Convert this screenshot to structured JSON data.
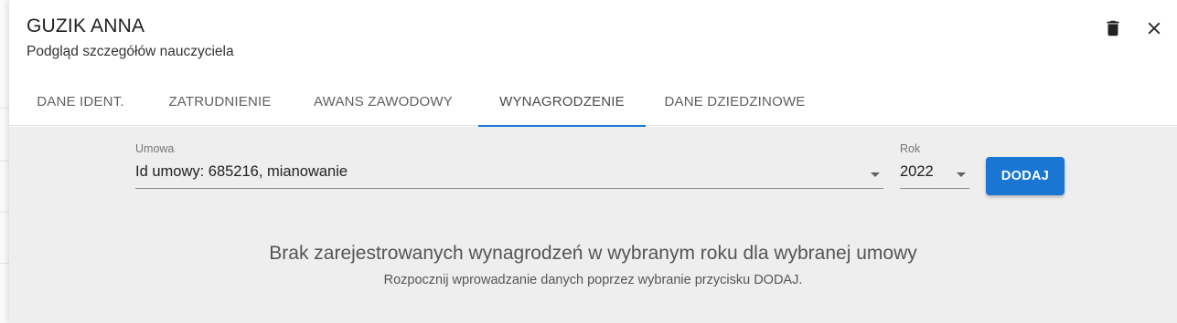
{
  "header": {
    "title": "GUZIK ANNA",
    "subtitle": "Podgląd szczegółów nauczyciela",
    "delete_icon": "trash-icon",
    "close_icon": "close-icon"
  },
  "tabs": [
    {
      "label": "DANE IDENT.",
      "active": false
    },
    {
      "label": "ZATRUDNIENIE",
      "active": false
    },
    {
      "label": "AWANS ZAWODOWY",
      "active": false
    },
    {
      "label": "WYNAGRODZENIE",
      "active": true
    },
    {
      "label": "DANE DZIEDZINOWE",
      "active": false
    }
  ],
  "form": {
    "contract_label": "Umowa",
    "contract_value": "Id umowy: 685216, mianowanie",
    "year_label": "Rok",
    "year_value": "2022",
    "add_label": "DODAJ"
  },
  "empty_state": {
    "title": "Brak zarejestrowanych wynagrodzeń w wybranym roku dla wybranej umowy",
    "message": "Rozpocznij wprowadzanie danych poprzez wybranie przycisku DODAJ."
  },
  "colors": {
    "accent": "#1976d2",
    "content_bg": "#eeeeee"
  }
}
